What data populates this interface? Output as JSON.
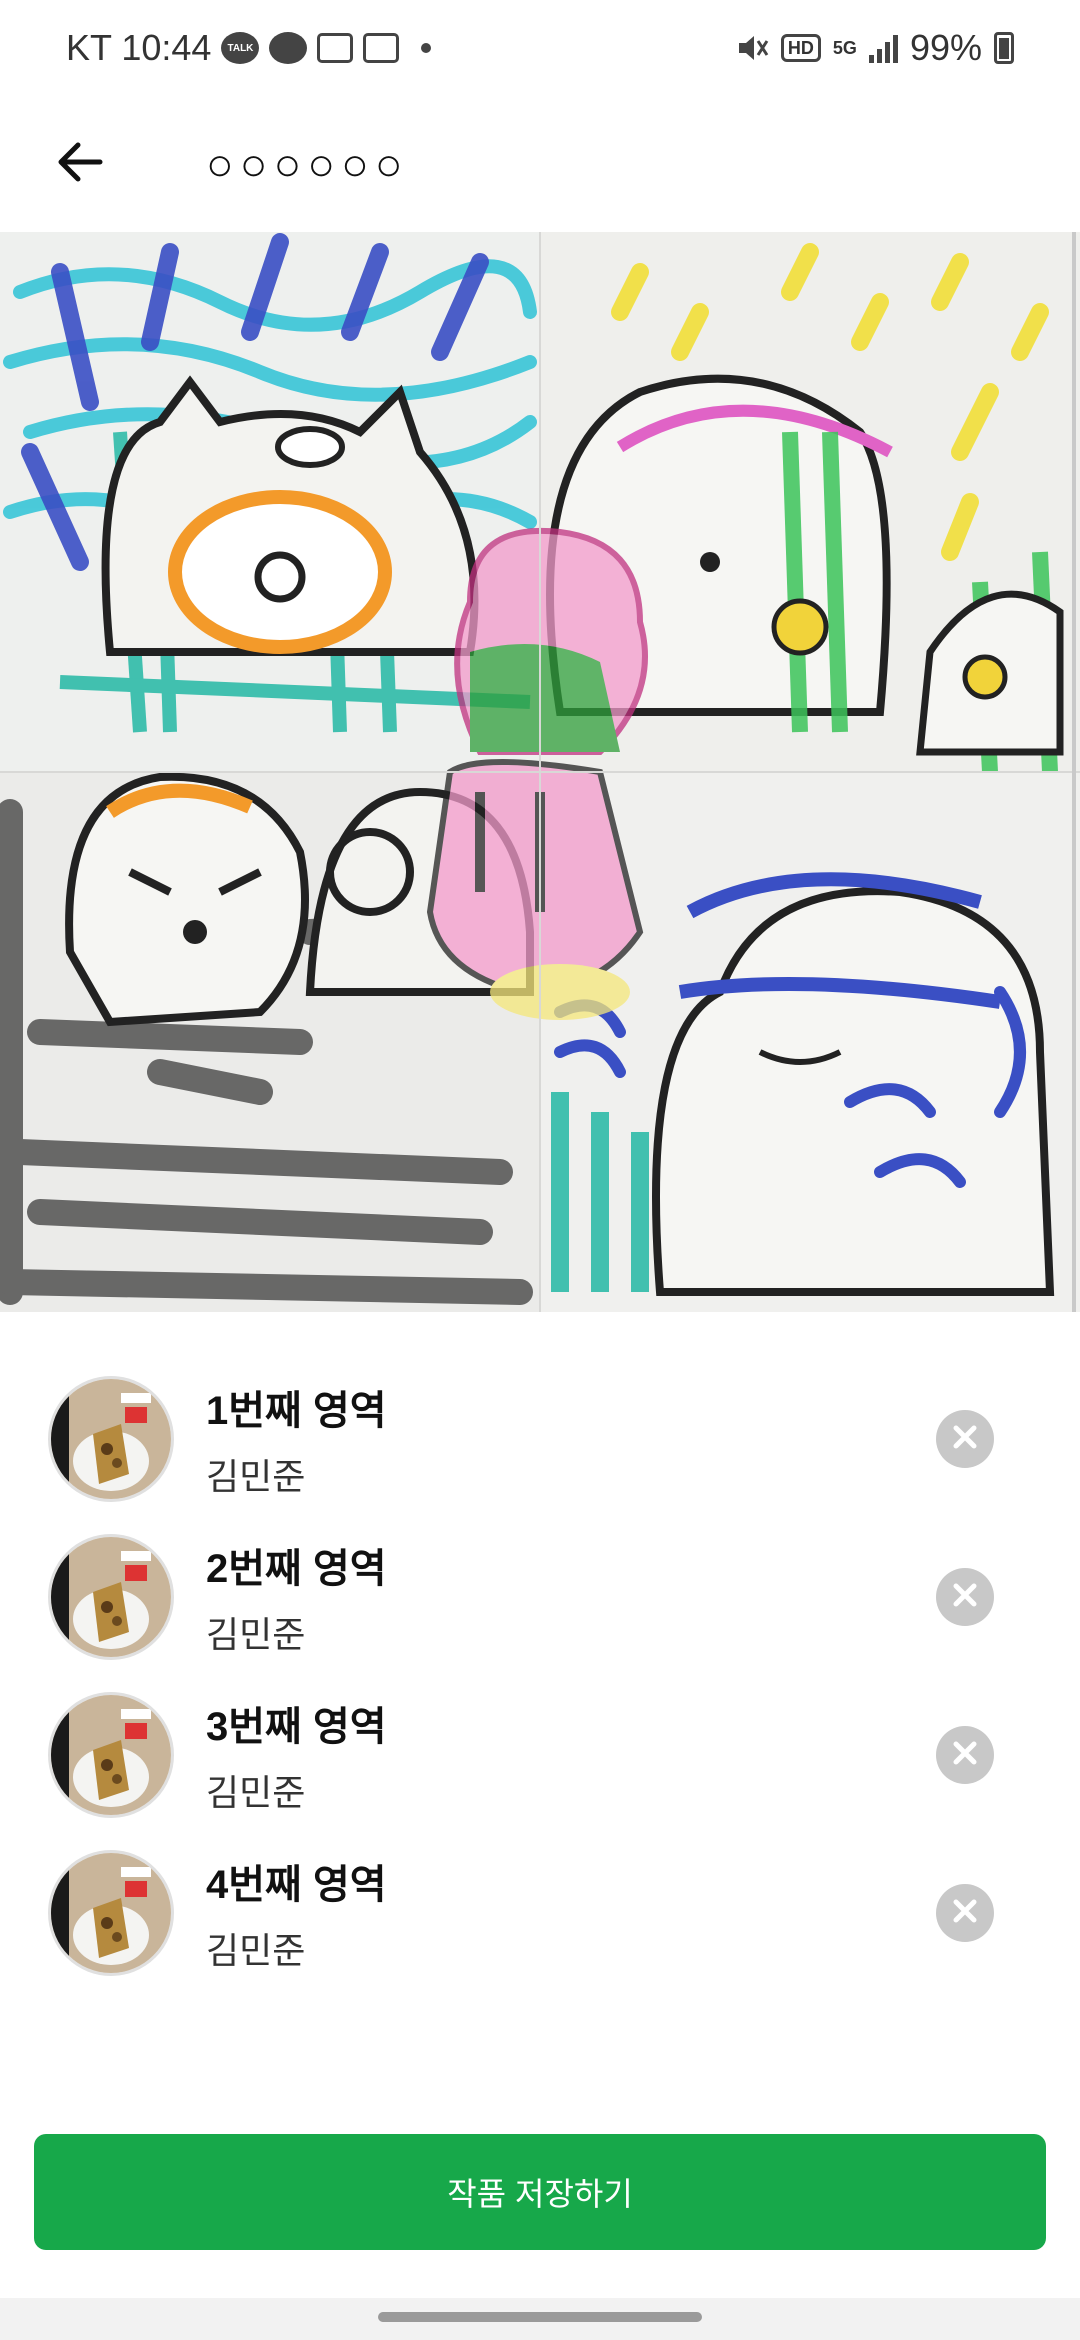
{
  "status_bar": {
    "carrier_time": "KT 10:44",
    "talk_label": "TALK",
    "hd_label": "HD",
    "network_label": "5G",
    "battery_text": "99%"
  },
  "header": {
    "title": "○○○○○○"
  },
  "regions": [
    {
      "title": "1번째 영역",
      "author": "김민준"
    },
    {
      "title": "2번째 영역",
      "author": "김민준"
    },
    {
      "title": "3번째 영역",
      "author": "김민준"
    },
    {
      "title": "4번째 영역",
      "author": "김민준"
    }
  ],
  "actions": {
    "save_label": "작품 저장하기"
  },
  "colors": {
    "accent": "#17a84a",
    "remove_icon_bg": "#c8c8c8"
  },
  "icons": {
    "back": "arrow-left-icon",
    "remove": "close-circle-icon"
  }
}
